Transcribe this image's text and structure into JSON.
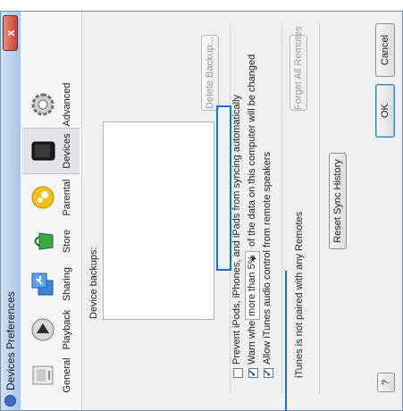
{
  "window": {
    "title": "Devices Preferences",
    "close_glyph": "x"
  },
  "toolbar": {
    "items": [
      {
        "label": "General",
        "icon": "general-icon"
      },
      {
        "label": "Playback",
        "icon": "playback-icon"
      },
      {
        "label": "Sharing",
        "icon": "sharing-icon"
      },
      {
        "label": "Store",
        "icon": "store-icon"
      },
      {
        "label": "Parental",
        "icon": "parental-icon"
      },
      {
        "label": "Devices",
        "icon": "devices-icon",
        "selected": true
      },
      {
        "label": "Advanced",
        "icon": "advanced-icon"
      }
    ]
  },
  "content": {
    "backups_label": "Device backups:",
    "delete_backup_label": "Delete Backup...",
    "prevent_sync": {
      "label": "Prevent iPods, iPhones, and iPads from syncing automatically",
      "checked": false
    },
    "warn": {
      "prefix": "Warn when",
      "value": "more than 5%",
      "suffix": "of the data on this computer will be changed",
      "checked": true
    },
    "allow_audio": {
      "label": "Allow iTunes audio control from remote speakers",
      "checked": true
    },
    "remotes_status": "iTunes is not paired with any Remotes",
    "forget_remotes_label": "Forget All Remotes",
    "reset_sync_label": "Reset Sync History"
  },
  "footer": {
    "help_label": "?",
    "ok_label": "OK",
    "cancel_label": "Cancel"
  },
  "colors": {
    "highlight": "#1a6fd0"
  }
}
